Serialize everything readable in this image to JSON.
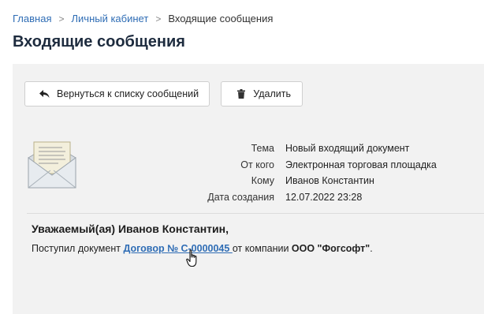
{
  "breadcrumb": {
    "items": [
      "Главная",
      "Личный кабинет"
    ],
    "current": "Входящие сообщения",
    "separator": ">"
  },
  "page_title": "Входящие сообщения",
  "toolbar": {
    "back_label": "Вернуться к списку сообщений",
    "delete_label": "Удалить"
  },
  "message": {
    "fields": [
      {
        "label": "Тема",
        "value": "Новый входящий документ"
      },
      {
        "label": "От кого",
        "value": "Электронная торговая площадка"
      },
      {
        "label": "Кому",
        "value": "Иванов Константин"
      },
      {
        "label": "Дата создания",
        "value": "12.07.2022 23:28"
      }
    ],
    "greeting": "Уважаемый(ая) Иванов Константин,",
    "body_prefix": "Поступил документ",
    "document_link": "Договор № С-0000045",
    "body_middle": "от компании",
    "company": "ООО \"Фогсофт\"",
    "body_suffix": "."
  },
  "icons": {
    "back": "reply-arrow-icon",
    "delete": "trash-icon",
    "envelope": "open-envelope-icon",
    "cursor": "hand-pointer-icon"
  },
  "colors": {
    "link": "#2f6db5",
    "title": "#1d2b3e",
    "panel_bg": "#f2f2f2"
  }
}
